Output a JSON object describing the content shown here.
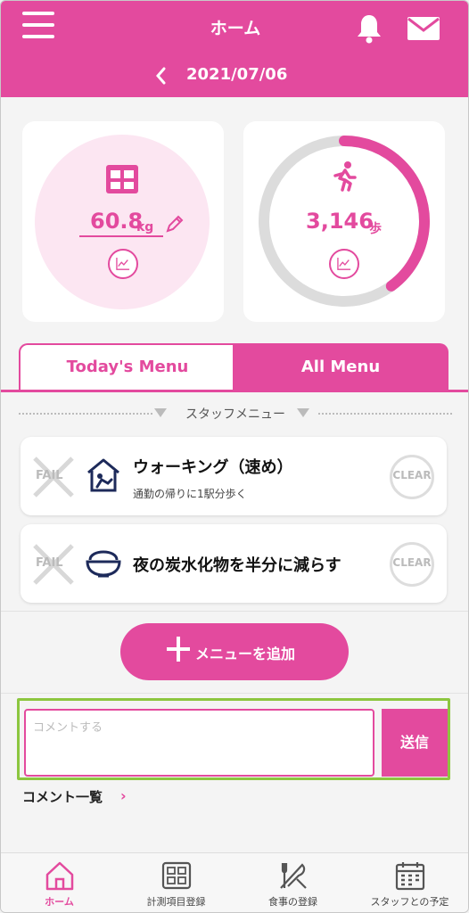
{
  "header": {
    "title": "ホーム",
    "date": "2021/07/06"
  },
  "weight": {
    "value": "60.8",
    "unit": "kg"
  },
  "steps": {
    "value": "3,146",
    "unit": "歩",
    "progress": 0.4
  },
  "tabs": [
    {
      "label": "Today's Menu",
      "active": false
    },
    {
      "label": "All Menu",
      "active": true
    }
  ],
  "section": {
    "label": "スタッフメニュー"
  },
  "menu_items": [
    {
      "title": "ウォーキング（速め）",
      "subtitle": "通勤の帰りに1駅分歩く",
      "icon": "commute-house-icon",
      "fail_label": "FAIL",
      "clear_label": "CLEAR"
    },
    {
      "title": "夜の炭水化物を半分に減らす",
      "subtitle": "",
      "icon": "rice-bowl-icon",
      "fail_label": "FAIL",
      "clear_label": "CLEAR"
    }
  ],
  "add_menu_label": "メニューを追加",
  "comment": {
    "placeholder": "コメントする",
    "value": "",
    "send_label": "送信",
    "list_label": "コメント一覧",
    "list_arrow": "›"
  },
  "bottom_nav": [
    {
      "label": "ホーム",
      "icon": "home-icon",
      "active": true
    },
    {
      "label": "計測項目登録",
      "icon": "scale-icon",
      "active": false
    },
    {
      "label": "食事の登録",
      "icon": "fork-knife-icon",
      "active": false
    },
    {
      "label": "スタッフとの予定",
      "icon": "calendar-icon",
      "active": false
    }
  ],
  "colors": {
    "accent": "#e34a9e",
    "accent_light": "#fce6f2",
    "highlight": "#8cc63f"
  }
}
